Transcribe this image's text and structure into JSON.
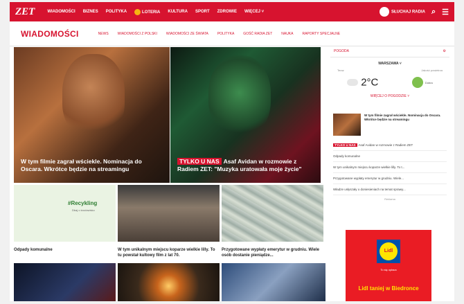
{
  "topbar": {
    "logo": "ZET",
    "nav": [
      "WIADOMOŚCI",
      "BIZNES",
      "POLITYKA",
      "LOTERIA",
      "KULTURA",
      "SPORT",
      "ZDROWIE",
      "WIĘCEJ"
    ],
    "listen": "SŁUCHAJ RADIA",
    "colors": {
      "brand": "#d7132f"
    }
  },
  "subheader": {
    "title": "WIADOMOŚCI",
    "links": [
      "NEWS",
      "WIADOMOŚCI Z POLSKI",
      "WIADOMOŚCI ZE ŚWIATA",
      "POLITYKA",
      "GOŚĆ RADIA ZET",
      "NAUKA",
      "RAPORTY SPECJALNE"
    ]
  },
  "hero": [
    {
      "tag": "",
      "title": "W tym filmie zagrał wściekle. Nominacja do Oscara. Wkrótce będzie na streamingu"
    },
    {
      "tag": "TYLKO U NAS",
      "title": "Asaf Avidan w rozmowie z Radiem ZET: \"Muzyka uratowała moje życie\""
    }
  ],
  "sidebar": {
    "weather_title": "POGODA",
    "city": "WARSZAWA",
    "label_now": "Teraz",
    "label_air": "Jakość powietrza",
    "temp": "2°C",
    "air_quality": "Dobra",
    "forecast_link": "WIĘCEJ O POGODZIE",
    "article_title": "W tym filmie zagrał wściekle. Nominacja do Oscara. Wkrótce będzie na streamingu",
    "list": [
      {
        "tag": "TYLKO U NAS",
        "text": "Asaf Avidan w rozmowie z Radiem ZET"
      },
      {
        "tag": "",
        "text": "Odpady komunalne"
      },
      {
        "tag": "",
        "text": "W tym unikalnym miejscu koparze wielkie lilly. To t..."
      },
      {
        "tag": "",
        "text": "Przygotowane wypłaty emerytur w grudniu. Wiele..."
      },
      {
        "tag": "",
        "text": "Władze usłyszały o doniesieniach na temat sprawy..."
      }
    ],
    "ad_label": "Reklama",
    "ad_brand": "Lidl",
    "ad_small": "To się opłaca",
    "ad_text": "Lidl taniej w Biedronce"
  },
  "cards": [
    {
      "title": "Odpady komunalne",
      "img_text": "#Recykling",
      "img_sub": "Dbaj o środowisko"
    },
    {
      "title": "W tym unikalnym miejscu koparze wielkie lilly. To tu powstał kultowy film z lat 70.",
      "img_text": "",
      "img_sub": ""
    },
    {
      "title": "Przygotowane wypłaty emerytur w grudniu. Wiele osób dostanie pieniądze...",
      "img_text": "",
      "img_sub": ""
    }
  ]
}
